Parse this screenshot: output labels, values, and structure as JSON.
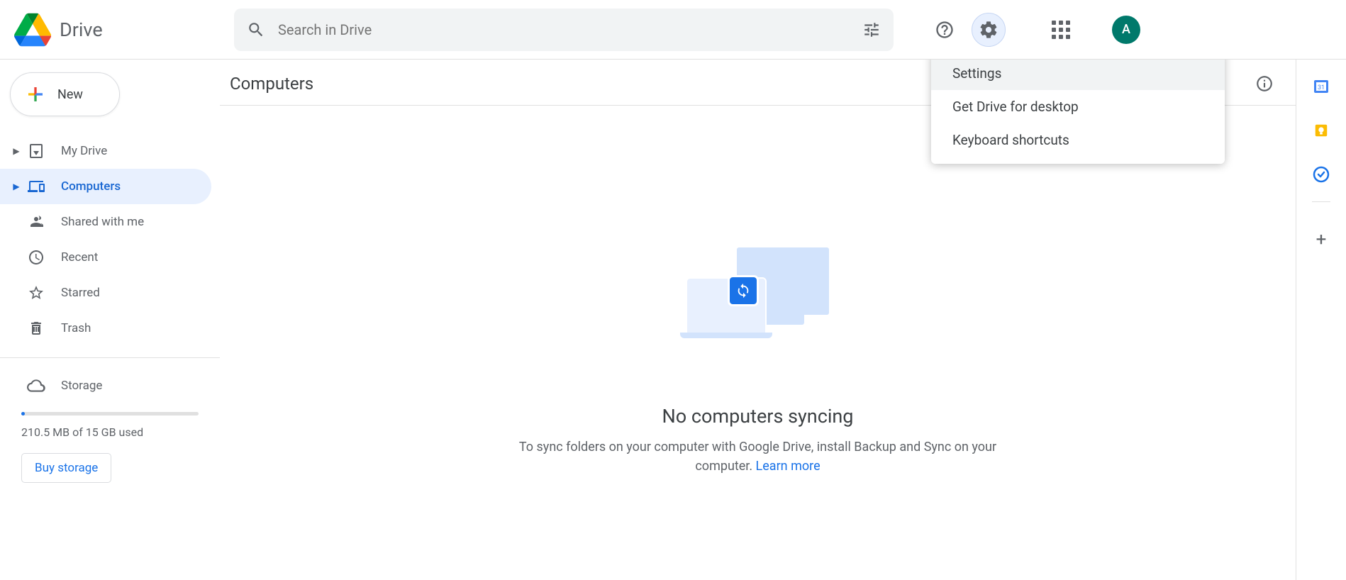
{
  "header": {
    "product": "Drive",
    "search_placeholder": "Search in Drive",
    "avatar_letter": "A"
  },
  "sidebar": {
    "new_label": "New",
    "items": [
      {
        "label": "My Drive",
        "expandable": true,
        "active": false
      },
      {
        "label": "Computers",
        "expandable": true,
        "active": true
      },
      {
        "label": "Shared with me",
        "expandable": false,
        "active": false
      },
      {
        "label": "Recent",
        "expandable": false,
        "active": false
      },
      {
        "label": "Starred",
        "expandable": false,
        "active": false
      },
      {
        "label": "Trash",
        "expandable": false,
        "active": false
      }
    ],
    "storage_label": "Storage",
    "storage_text": "210.5 MB of 15 GB used",
    "buy_label": "Buy storage"
  },
  "main": {
    "title": "Computers",
    "empty_title": "No computers syncing",
    "empty_subtitle": "To sync folders on your computer with Google Drive, install Backup and Sync on your computer. ",
    "learn_more": "Learn more"
  },
  "menu": {
    "items": [
      "Settings",
      "Get Drive for desktop",
      "Keyboard shortcuts"
    ]
  },
  "side_apps": [
    "calendar",
    "keep",
    "tasks"
  ]
}
